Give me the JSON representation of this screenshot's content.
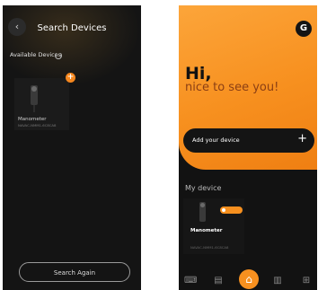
{
  "search_screen": {
    "back_icon": "arrow-left-icon",
    "title": "Search Devices",
    "available_label": "Available Devices",
    "device": {
      "name": "Manometer",
      "serial": "NAVAC-NMM1-6C8CA8"
    },
    "add_icon": "+",
    "search_again_label": "Search Again"
  },
  "home_screen": {
    "avatar_initial": "G",
    "greeting_hi": "Hi,",
    "greeting_sub": "nice to see you!",
    "add_device_label": "Add your device",
    "add_icon": "+",
    "section_title": "My device",
    "device": {
      "name": "Manometer",
      "serial": "NAVAC-NMM1-6C8CA8",
      "toggle_on": true
    },
    "nav": [
      {
        "icon": "keyboard-icon",
        "glyph": "⌨"
      },
      {
        "icon": "clipboard-icon",
        "glyph": "▤"
      },
      {
        "icon": "home-icon",
        "glyph": "⌂"
      },
      {
        "icon": "report-icon",
        "glyph": "▥"
      },
      {
        "icon": "grid-icon",
        "glyph": "⊞"
      }
    ]
  },
  "colors": {
    "accent": "#f7901f",
    "background": "#141414"
  }
}
